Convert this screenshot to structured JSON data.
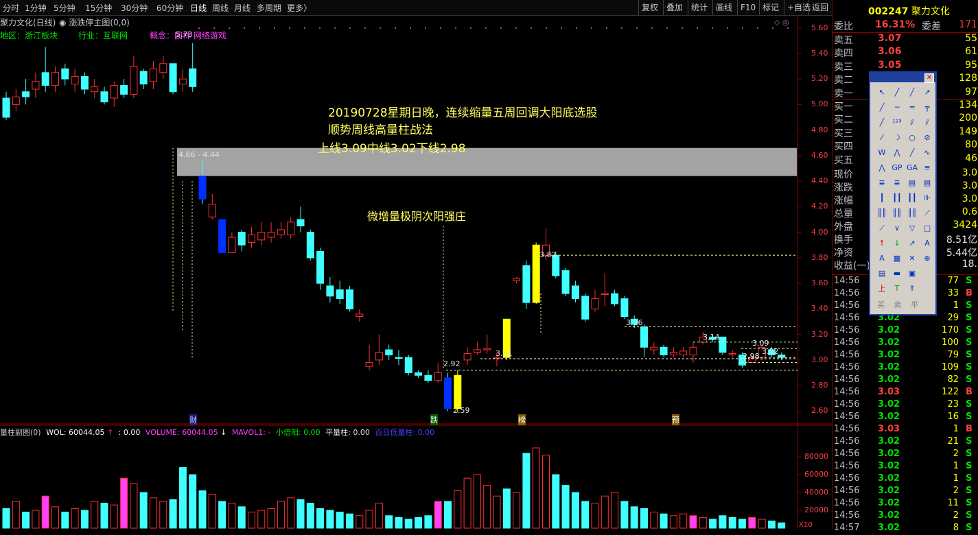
{
  "period_tabs": [
    "分时",
    "1分钟",
    "5分钟",
    "15分钟",
    "30分钟",
    "60分钟",
    "日线",
    "周线",
    "月线",
    "多周期",
    "更多〉"
  ],
  "active_period": "日线",
  "right_buttons": [
    "复权",
    "叠加",
    "统计",
    "画线",
    "F10",
    "标记",
    "+自选",
    "返回"
  ],
  "chart_title": "聚力文化(日线)",
  "indicator_title": "涨跌停主图(0,0)",
  "region_label": "地区：浙江板块",
  "industry_label": "行业：互联网",
  "concept_label": "概念：",
  "concept_items": "园林 网络游戏",
  "price_axis": [
    "5.60",
    "5.40",
    "5.20",
    "5.00",
    "4.80",
    "4.60",
    "4.40",
    "4.20",
    "4.00",
    "3.80",
    "3.60",
    "3.40",
    "3.20",
    "3.00",
    "2.80",
    "2.60"
  ],
  "annotations": {
    "title_line": "20190728星期日晚，连续缩量五周回调大阳底选股",
    "subtitle_line": "顺势周线高量柱战法",
    "levels_line": "上线3.09中线3.02下线2.98",
    "pattern_line": "微增量极阴次阳强庄",
    "range_label": "4.66 - 4.44",
    "high_label": "5.73",
    "low_label": "2.59",
    "price_marks": [
      "3.82",
      "3.26",
      "3.14",
      "3.09",
      "3.02",
      "2.98",
      "3.01",
      "2.92"
    ]
  },
  "event_marks": [
    "财",
    "跌",
    "榜",
    "预"
  ],
  "sub_chart": {
    "title": "量柱副图(0)",
    "wol": "WOL: 60044.05",
    "arrow_val": ": 0.00",
    "volume": "VOLUME: 60044.05",
    "mavol": "MAVOL1: -",
    "xiaobeiyang": "小倍阳: 0.00",
    "pingliangzhu": "平量柱: 0.00",
    "bairi": "百日低量柱: 0.00",
    "axis": [
      "80000",
      "60000",
      "40000",
      "20000"
    ],
    "axis_unit": "X10"
  },
  "stock": {
    "code": "002247",
    "name": "聚力文化",
    "weibi_label": "委比",
    "weibi_value": "16.31%",
    "weicha_label": "委差",
    "weicha_value": "171"
  },
  "order_book": [
    {
      "label": "卖五",
      "price": "3.07",
      "vol": "55"
    },
    {
      "label": "卖四",
      "price": "3.06",
      "vol": "61"
    },
    {
      "label": "卖三",
      "price": "3.05",
      "vol": "95"
    },
    {
      "label": "卖二",
      "price": "",
      "vol": "128"
    },
    {
      "label": "卖一",
      "price": "",
      "vol": "97"
    },
    {
      "label": "买一",
      "price": "",
      "vol": "134"
    },
    {
      "label": "买二",
      "price": "",
      "vol": "200"
    },
    {
      "label": "买三",
      "price": "",
      "vol": "149"
    },
    {
      "label": "买四",
      "price": "",
      "vol": "80"
    },
    {
      "label": "买五",
      "price": "",
      "vol": "46"
    }
  ],
  "quote_info": [
    {
      "label": "现价",
      "value": "3.0"
    },
    {
      "label": "涨跌",
      "value": "3.0"
    },
    {
      "label": "涨幅",
      "value": "3.0"
    },
    {
      "label": "总量",
      "value": "0.6"
    },
    {
      "label": "外盘",
      "value": "3424"
    },
    {
      "label": "换手",
      "value": "8.51亿"
    },
    {
      "label": "净资",
      "value": "5.44亿"
    },
    {
      "label": "收益(一)",
      "value": "18."
    }
  ],
  "ticks": [
    {
      "time": "14:56",
      "price": "",
      "vol": "77",
      "side": "S"
    },
    {
      "time": "14:56",
      "price": "",
      "vol": "33",
      "side": "B"
    },
    {
      "time": "14:56",
      "price": "",
      "vol": "1",
      "side": "S"
    },
    {
      "time": "14:56",
      "price": "3.02",
      "vol": "29",
      "side": "S"
    },
    {
      "time": "14:56",
      "price": "3.02",
      "vol": "170",
      "side": "S"
    },
    {
      "time": "14:56",
      "price": "3.02",
      "vol": "100",
      "side": "S"
    },
    {
      "time": "14:56",
      "price": "3.02",
      "vol": "79",
      "side": "S"
    },
    {
      "time": "14:56",
      "price": "3.02",
      "vol": "109",
      "side": "S"
    },
    {
      "time": "14:56",
      "price": "3.02",
      "vol": "82",
      "side": "S"
    },
    {
      "time": "14:56",
      "price": "3.03",
      "vol": "122",
      "side": "B"
    },
    {
      "time": "14:56",
      "price": "3.02",
      "vol": "23",
      "side": "S"
    },
    {
      "time": "14:56",
      "price": "3.02",
      "vol": "16",
      "side": "S"
    },
    {
      "time": "14:56",
      "price": "3.03",
      "vol": "1",
      "side": "B"
    },
    {
      "time": "14:56",
      "price": "3.02",
      "vol": "21",
      "side": "S"
    },
    {
      "time": "14:56",
      "price": "3.02",
      "vol": "2",
      "side": "S"
    },
    {
      "time": "14:56",
      "price": "3.02",
      "vol": "1",
      "side": "S"
    },
    {
      "time": "14:56",
      "price": "3.02",
      "vol": "1",
      "side": "S"
    },
    {
      "time": "14:56",
      "price": "3.02",
      "vol": "2",
      "side": "S"
    },
    {
      "time": "14:56",
      "price": "3.02",
      "vol": "11",
      "side": "S"
    },
    {
      "time": "14:56",
      "price": "3.02",
      "vol": "2",
      "side": "S"
    },
    {
      "time": "14:57",
      "price": "3.02",
      "vol": "8",
      "side": "S"
    }
  ],
  "toolbox_bottom": [
    "买",
    "卖",
    "平"
  ],
  "colors": {
    "up": "#ff3030",
    "down": "#40ffff",
    "bg": "#000000",
    "accent_yellow": "#ffff00",
    "accent_blue": "#0000ff"
  },
  "chart_data": {
    "type": "candlestick",
    "ylim": [
      2.5,
      5.7
    ],
    "candles": [
      [
        5.05,
        4.9,
        5.1,
        4.88,
        "d"
      ],
      [
        5.0,
        5.06,
        5.12,
        4.95,
        "u"
      ],
      [
        5.1,
        5.06,
        5.2,
        5.0,
        "d"
      ],
      [
        5.12,
        5.18,
        5.25,
        5.05,
        "u"
      ],
      [
        5.25,
        5.15,
        5.45,
        5.1,
        "d"
      ],
      [
        5.15,
        5.25,
        5.3,
        5.1,
        "u"
      ],
      [
        5.28,
        5.2,
        5.32,
        5.15,
        "d"
      ],
      [
        5.16,
        5.22,
        5.28,
        5.1,
        "u"
      ],
      [
        5.22,
        5.12,
        5.25,
        5.08,
        "d"
      ],
      [
        5.1,
        5.14,
        5.2,
        5.05,
        "u"
      ],
      [
        5.1,
        5.02,
        5.14,
        5.0,
        "d"
      ],
      [
        5.05,
        5.15,
        5.18,
        4.98,
        "u"
      ],
      [
        5.15,
        5.08,
        5.2,
        5.05,
        "d"
      ],
      [
        5.08,
        5.3,
        5.38,
        5.05,
        "u"
      ],
      [
        5.26,
        5.16,
        5.28,
        5.12,
        "d"
      ],
      [
        5.18,
        5.28,
        5.34,
        5.12,
        "u"
      ],
      [
        5.25,
        5.32,
        5.38,
        5.2,
        "u"
      ],
      [
        5.32,
        5.1,
        5.32,
        5.08,
        "d"
      ],
      [
        5.16,
        5.2,
        5.28,
        5.1,
        "u"
      ],
      [
        5.28,
        5.14,
        5.48,
        5.1,
        "d"
      ],
      [
        4.44,
        4.26,
        4.56,
        4.22,
        "b"
      ],
      [
        4.22,
        4.12,
        4.3,
        4.1,
        "u"
      ],
      [
        4.1,
        3.84,
        4.1,
        3.84,
        "b"
      ],
      [
        3.84,
        3.96,
        4.0,
        3.84,
        "u"
      ],
      [
        4.0,
        3.9,
        4.02,
        3.85,
        "d"
      ],
      [
        3.92,
        3.98,
        4.04,
        3.88,
        "u"
      ],
      [
        3.94,
        4.0,
        4.08,
        3.9,
        "u"
      ],
      [
        4.0,
        3.96,
        4.08,
        3.92,
        "u"
      ],
      [
        3.98,
        4.02,
        4.08,
        3.95,
        "u"
      ],
      [
        3.98,
        4.08,
        4.12,
        3.95,
        "u"
      ],
      [
        4.1,
        4.05,
        4.2,
        4.0,
        "d"
      ],
      [
        4.0,
        3.8,
        4.02,
        3.78,
        "d"
      ],
      [
        3.85,
        3.6,
        3.88,
        3.55,
        "d"
      ],
      [
        3.58,
        3.5,
        3.65,
        3.45,
        "d"
      ],
      [
        3.55,
        3.48,
        3.62,
        3.44,
        "d"
      ],
      [
        3.55,
        3.4,
        3.58,
        3.38,
        "d"
      ],
      [
        3.36,
        3.34,
        3.4,
        3.3,
        "u"
      ],
      [
        2.95,
        2.98,
        3.12,
        2.92,
        "u"
      ],
      [
        3.0,
        3.06,
        3.2,
        2.96,
        "u"
      ],
      [
        3.08,
        3.04,
        3.12,
        3.0,
        "d"
      ],
      [
        3.02,
        3.02,
        3.08,
        2.96,
        "d"
      ],
      [
        3.02,
        2.9,
        3.04,
        2.88,
        "d"
      ],
      [
        2.9,
        2.88,
        2.92,
        2.86,
        "d"
      ],
      [
        2.88,
        2.84,
        2.92,
        2.82,
        "d"
      ],
      [
        2.84,
        2.9,
        2.98,
        2.82,
        "u"
      ],
      [
        2.86,
        2.62,
        2.9,
        2.6,
        "b"
      ],
      [
        2.62,
        2.88,
        2.92,
        2.59,
        "y"
      ],
      [
        3.0,
        3.05,
        3.1,
        2.96,
        "u"
      ],
      [
        3.06,
        3.08,
        3.14,
        3.04,
        "u"
      ],
      [
        3.08,
        3.09,
        3.2,
        3.05,
        "u"
      ],
      [
        3.02,
        3.02,
        3.06,
        2.95,
        "u"
      ],
      [
        3.02,
        3.32,
        3.32,
        3.0,
        "y"
      ],
      [
        3.64,
        3.62,
        3.65,
        3.6,
        "u"
      ],
      [
        3.74,
        3.45,
        3.78,
        3.4,
        "d"
      ],
      [
        3.45,
        3.9,
        3.92,
        3.44,
        "y"
      ],
      [
        3.82,
        3.9,
        4.03,
        3.78,
        "u"
      ],
      [
        3.82,
        3.66,
        3.85,
        3.64,
        "d"
      ],
      [
        3.7,
        3.52,
        3.72,
        3.5,
        "d"
      ],
      [
        3.58,
        3.48,
        3.62,
        3.45,
        "d"
      ],
      [
        3.5,
        3.32,
        3.52,
        3.3,
        "d"
      ],
      [
        3.4,
        3.48,
        3.55,
        3.38,
        "u"
      ],
      [
        3.52,
        3.52,
        3.68,
        3.42,
        "u"
      ],
      [
        3.52,
        3.44,
        3.55,
        3.42,
        "d"
      ],
      [
        3.48,
        3.34,
        3.5,
        3.32,
        "d"
      ],
      [
        3.32,
        3.28,
        3.35,
        3.25,
        "d"
      ],
      [
        3.26,
        3.1,
        3.28,
        3.02,
        "d"
      ],
      [
        3.1,
        3.08,
        3.14,
        3.04,
        "u"
      ],
      [
        3.1,
        3.04,
        3.12,
        3.02,
        "d"
      ],
      [
        3.04,
        3.06,
        3.1,
        3.02,
        "u"
      ],
      [
        3.04,
        3.07,
        3.1,
        3.02,
        "u"
      ],
      [
        3.04,
        3.1,
        3.14,
        2.98,
        "u"
      ],
      [
        3.14,
        3.18,
        3.22,
        3.12,
        "u"
      ],
      [
        3.18,
        3.16,
        3.2,
        3.14,
        "d"
      ],
      [
        3.18,
        3.06,
        3.18,
        3.04,
        "d"
      ],
      [
        3.05,
        3.05,
        3.08,
        3.02,
        "u"
      ],
      [
        3.04,
        2.96,
        3.06,
        2.94,
        "d"
      ],
      [
        2.98,
        3.02,
        3.04,
        2.98,
        "u"
      ],
      [
        3.02,
        3.1,
        3.12,
        3.0,
        "u"
      ],
      [
        3.08,
        3.04,
        3.1,
        3.02,
        "d"
      ],
      [
        3.04,
        3.02,
        3.06,
        3.0,
        "d"
      ]
    ],
    "volumes": [
      [
        22000,
        "d"
      ],
      [
        30000,
        "u"
      ],
      [
        18000,
        "d"
      ],
      [
        20000,
        "u"
      ],
      [
        36000,
        "m"
      ],
      [
        24000,
        "u"
      ],
      [
        18000,
        "d"
      ],
      [
        22000,
        "u"
      ],
      [
        20000,
        "d"
      ],
      [
        30000,
        "u"
      ],
      [
        28000,
        "d"
      ],
      [
        26000,
        "u"
      ],
      [
        56000,
        "m"
      ],
      [
        50000,
        "u"
      ],
      [
        40000,
        "d"
      ],
      [
        34000,
        "u"
      ],
      [
        30000,
        "u"
      ],
      [
        32000,
        "d"
      ],
      [
        68000,
        "d"
      ],
      [
        60000,
        "d"
      ],
      [
        42000,
        "d"
      ],
      [
        38000,
        "u"
      ],
      [
        30000,
        "d"
      ],
      [
        28000,
        "u"
      ],
      [
        24000,
        "d"
      ],
      [
        18000,
        "u"
      ],
      [
        20000,
        "u"
      ],
      [
        22000,
        "u"
      ],
      [
        30000,
        "u"
      ],
      [
        34000,
        "u"
      ],
      [
        32000,
        "d"
      ],
      [
        28000,
        "d"
      ],
      [
        22000,
        "d"
      ],
      [
        20000,
        "d"
      ],
      [
        18000,
        "d"
      ],
      [
        16000,
        "d"
      ],
      [
        14000,
        "u"
      ],
      [
        20000,
        "u"
      ],
      [
        28000,
        "u"
      ],
      [
        14000,
        "d"
      ],
      [
        12000,
        "d"
      ],
      [
        10000,
        "d"
      ],
      [
        12000,
        "d"
      ],
      [
        14000,
        "d"
      ],
      [
        30000,
        "m"
      ],
      [
        30000,
        "d"
      ],
      [
        42000,
        "u"
      ],
      [
        56000,
        "u"
      ],
      [
        60000,
        "u"
      ],
      [
        48000,
        "u"
      ],
      [
        36000,
        "u"
      ],
      [
        44000,
        "d"
      ],
      [
        40000,
        "u"
      ],
      [
        84000,
        "d"
      ],
      [
        90000,
        "u"
      ],
      [
        82000,
        "u"
      ],
      [
        60000,
        "d"
      ],
      [
        48000,
        "d"
      ],
      [
        40000,
        "d"
      ],
      [
        30000,
        "d"
      ],
      [
        28000,
        "u"
      ],
      [
        36000,
        "u"
      ],
      [
        40000,
        "u"
      ],
      [
        30000,
        "d"
      ],
      [
        24000,
        "d"
      ],
      [
        22000,
        "d"
      ],
      [
        18000,
        "u"
      ],
      [
        16000,
        "d"
      ],
      [
        14000,
        "u"
      ],
      [
        16000,
        "u"
      ],
      [
        14000,
        "m"
      ],
      [
        12000,
        "u"
      ],
      [
        10000,
        "d"
      ],
      [
        14000,
        "d"
      ],
      [
        12000,
        "d"
      ],
      [
        10000,
        "d"
      ],
      [
        12000,
        "m"
      ],
      [
        10000,
        "u"
      ],
      [
        8000,
        "d"
      ],
      [
        6000,
        "d"
      ]
    ]
  }
}
